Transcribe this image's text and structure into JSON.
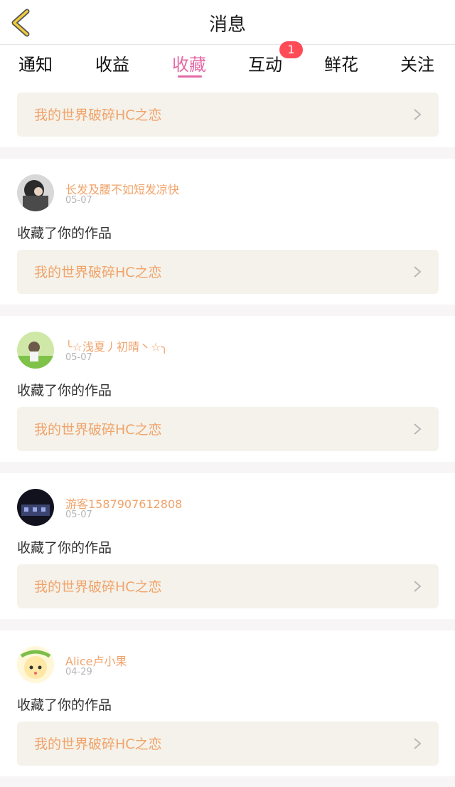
{
  "header": {
    "title": "消息",
    "back_icon": "chevron-left-icon"
  },
  "tabs": [
    {
      "label": "通知"
    },
    {
      "label": "收益"
    },
    {
      "label": "收藏",
      "active": true
    },
    {
      "label": "互动",
      "badge": "1"
    },
    {
      "label": "鲜花"
    },
    {
      "label": "关注"
    }
  ],
  "colors": {
    "accent": "#e36aa6",
    "username": "#f1a36a",
    "badge": "#ff4b57",
    "work_bg": "#f4f2ea"
  },
  "top_card": {
    "work_title": "我的世界破碎HC之恋"
  },
  "items": [
    {
      "username": "长发及腰不如短发凉快",
      "date": "05-07",
      "action": "收藏了你的作品",
      "work_title": "我的世界破碎HC之恋"
    },
    {
      "username": "╰☆浅夏丿初晴丶☆╮",
      "date": "05-07",
      "action": "收藏了你的作品",
      "work_title": "我的世界破碎HC之恋"
    },
    {
      "username": "游客1587907612808",
      "date": "05-07",
      "action": "收藏了你的作品",
      "work_title": "我的世界破碎HC之恋"
    },
    {
      "username": "Alice卢小果",
      "date": "04-29",
      "action": "收藏了你的作品",
      "work_title": "我的世界破碎HC之恋"
    }
  ]
}
